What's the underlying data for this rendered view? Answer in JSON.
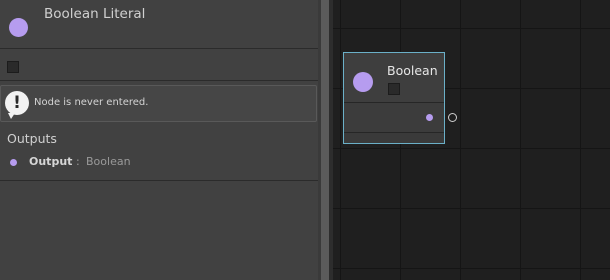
{
  "inspector": {
    "node_title": "Boolean Literal",
    "node_color": "#b69cef",
    "value_checked": false,
    "warning": {
      "icon": "exclamation-icon",
      "message": "Node is never entered."
    },
    "outputs_title": "Outputs",
    "outputs": [
      {
        "name": "Output",
        "separator": ":",
        "type": "Boolean"
      }
    ]
  },
  "graph": {
    "node": {
      "title": "Boolean",
      "value_checked": false,
      "selected": true,
      "accent_color": "#6bb0c8"
    }
  }
}
